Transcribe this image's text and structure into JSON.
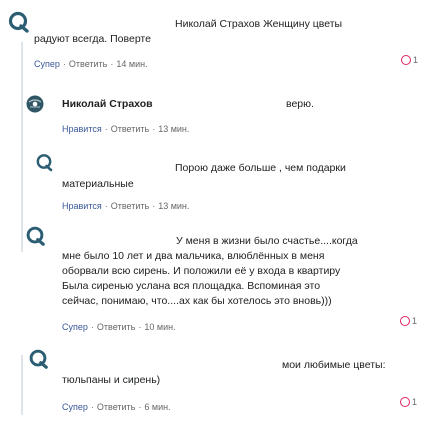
{
  "comments": [
    {
      "author": "Николай Страхов",
      "line1": "Женщину цветы",
      "line2": "радуют всегда. Поверте",
      "like_label": "Супер",
      "reply_label": "Ответить",
      "time": "14 мин.",
      "reaction_count": "1",
      "reaction_color": "#e0245e"
    },
    {
      "author": "Николай Страхов",
      "trailing": "верю.",
      "like_label": "Нравится",
      "reply_label": "Ответить",
      "time": "13 мин."
    },
    {
      "line1": "Порою даже больше , чем подарки",
      "line2": "материальные",
      "like_label": "Нравится",
      "reply_label": "Ответить",
      "time": "13 мин."
    },
    {
      "lines": [
        "У меня в жизни было счастье....когда",
        "мне было 10 лет и два мальчика, влюблённых в меня",
        "оборвали всю сирень. И положили её у входа в квартиру",
        "Была сиренью услана вся площадка. Вспоминая это",
        "сейчас, понимаю, что....ах как бы хотелось это вновь)))"
      ],
      "like_label": "Супер",
      "reply_label": "Ответить",
      "time": "10 мин.",
      "reaction_count": "1"
    },
    {
      "line1": "мои любимые цветы:",
      "line2": "тюльпаны и сирень)",
      "like_label": "Супер",
      "reply_label": "Ответить",
      "time": "6 мин.",
      "reaction_count": "1"
    }
  ],
  "separator": "·",
  "colors": {
    "link": "#385898",
    "meta": "#65676b",
    "reaction": "#e0245e",
    "thread_line": "#dfe3ea"
  }
}
